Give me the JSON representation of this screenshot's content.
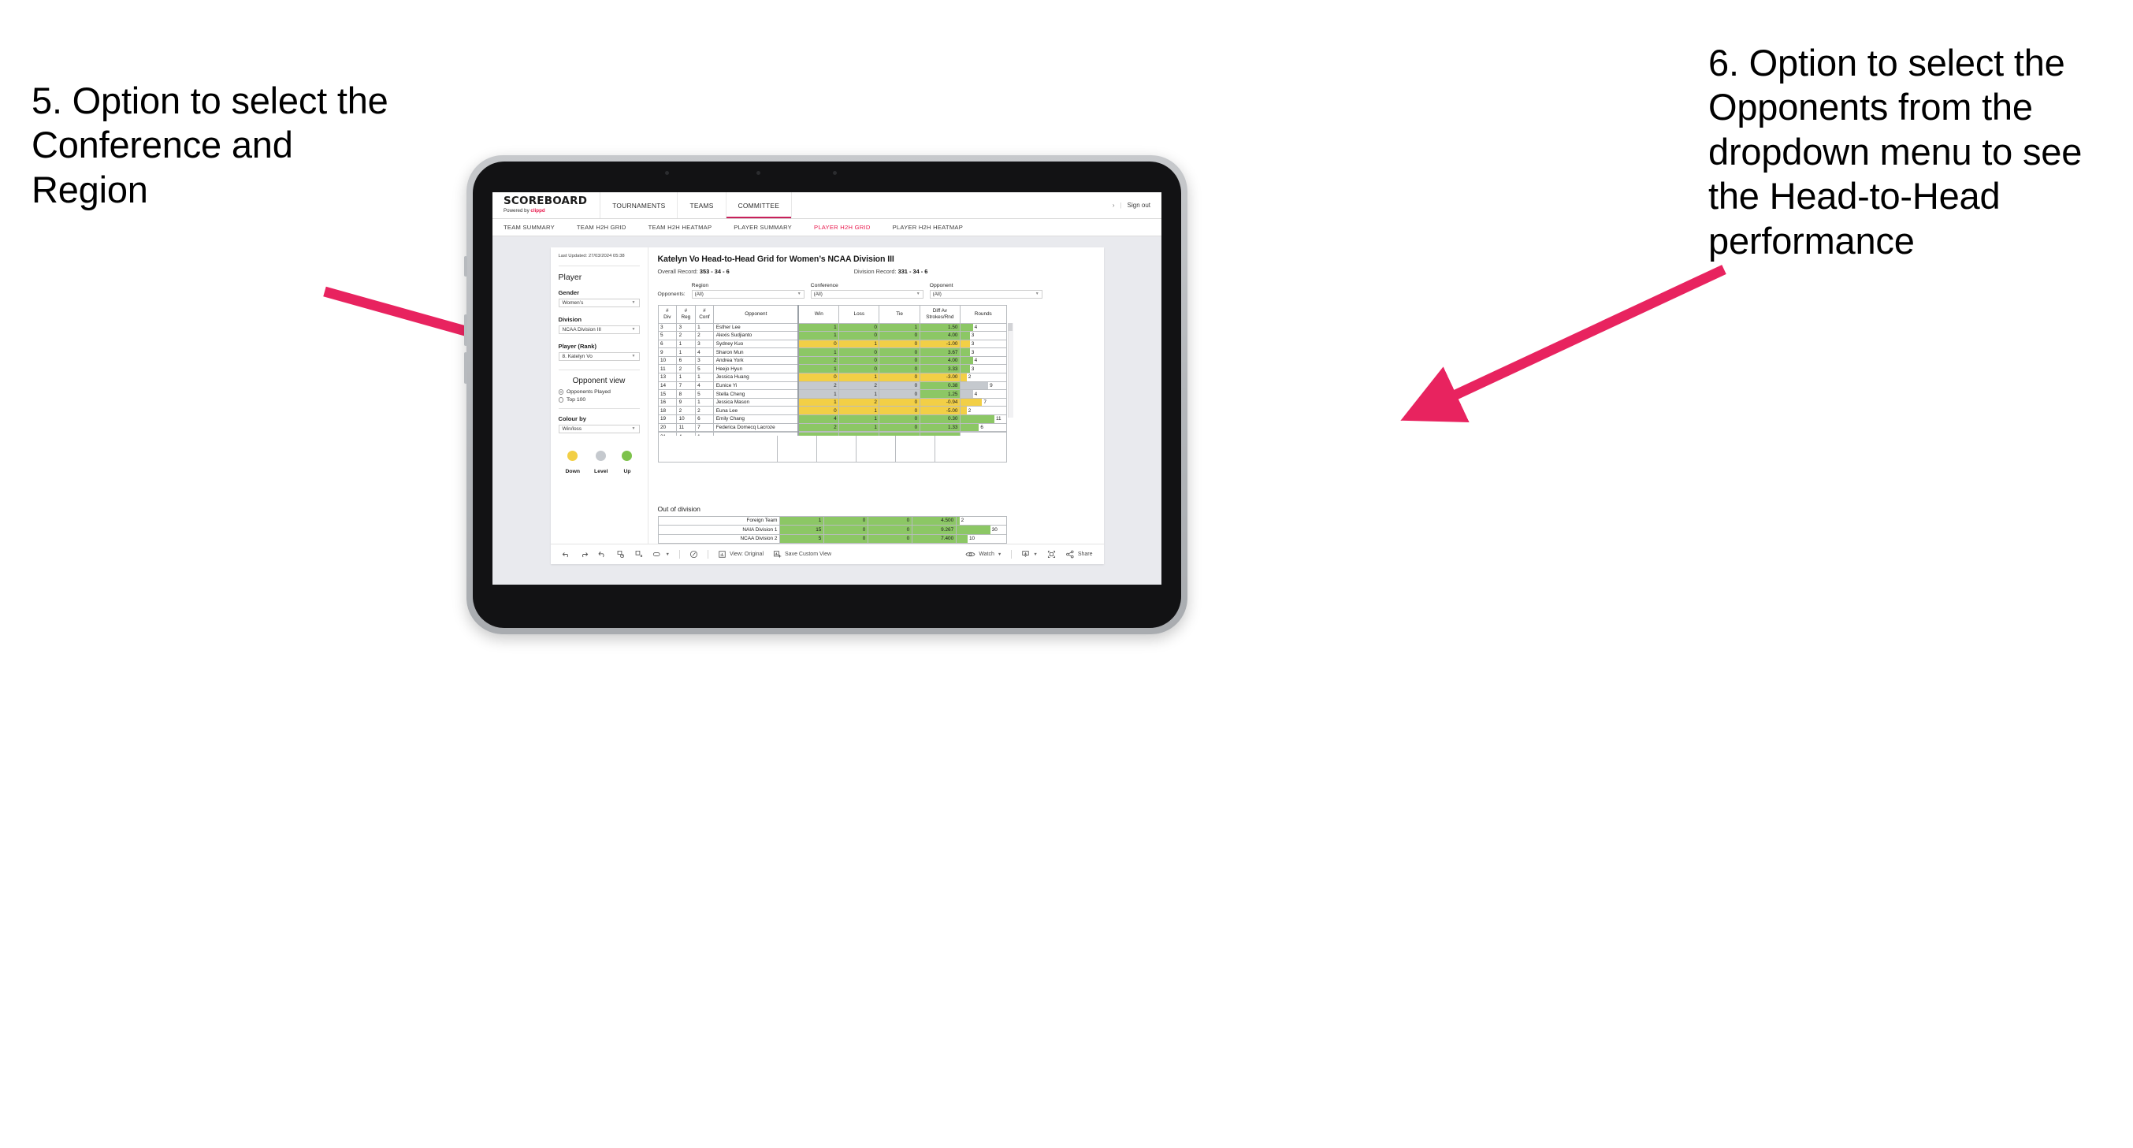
{
  "annotations": {
    "left": "5. Option to select the Conference and Region",
    "right": "6. Option to select the Opponents from the dropdown menu to see the Head-to-Head performance",
    "arrow_color": "#E8235F"
  },
  "app": {
    "brand": {
      "title": "SCOREBOARD",
      "powered_prefix": "Powered by ",
      "powered_brand": "clippd"
    },
    "topnav": [
      {
        "label": "TOURNAMENTS",
        "active": false
      },
      {
        "label": "TEAMS",
        "active": false
      },
      {
        "label": "COMMITTEE",
        "active": true
      }
    ],
    "topnav_right": {
      "chevron": "›",
      "divider": "|",
      "sign_out": "Sign out"
    },
    "subnav": [
      {
        "label": "TEAM SUMMARY",
        "active": false
      },
      {
        "label": "TEAM H2H GRID",
        "active": false
      },
      {
        "label": "TEAM H2H HEATMAP",
        "active": false
      },
      {
        "label": "PLAYER SUMMARY",
        "active": false
      },
      {
        "label": "PLAYER H2H GRID",
        "active": true
      },
      {
        "label": "PLAYER H2H HEATMAP",
        "active": false
      }
    ]
  },
  "sidebar": {
    "last_updated": "Last Updated: 27/03/2024 05:38",
    "section_player": "Player",
    "fields": [
      {
        "label": "Gender",
        "value": "Women’s"
      },
      {
        "label": "Division",
        "value": "NCAA Division III"
      },
      {
        "label": "Player (Rank)",
        "value": "8. Katelyn Vo"
      }
    ],
    "opponent_view": {
      "heading": "Opponent view",
      "options": [
        {
          "label": "Opponents Played",
          "selected": true
        },
        {
          "label": "Top 100",
          "selected": false
        }
      ]
    },
    "colour_by": {
      "label": "Colour by",
      "value": "Win/loss"
    },
    "legend": [
      {
        "label": "Down",
        "color": "#F2CF46"
      },
      {
        "label": "Level",
        "color": "#C5C9CE"
      },
      {
        "label": "Up",
        "color": "#7DC24B"
      }
    ]
  },
  "main": {
    "title": "Katelyn Vo Head-to-Head Grid for Women’s NCAA Division III",
    "overall_record_label": "Overall Record: ",
    "overall_record_value": "353 - 34 - 6",
    "division_record_label": "Division Record: ",
    "division_record_value": "331 -  34 - 6",
    "filters_label": "Opponents:",
    "filters": [
      {
        "label": "Region",
        "value": "(All)"
      },
      {
        "label": "Conference",
        "value": "(All)"
      },
      {
        "label": "Opponent",
        "value": "(All)"
      }
    ]
  },
  "chart_data": {
    "type": "table",
    "title": "Katelyn Vo Head-to-Head Grid for Women’s NCAA Division III",
    "columns": [
      "# Div",
      "# Reg",
      "# Conf",
      "Opponent",
      "Win",
      "Loss",
      "Tie",
      "Diff Av Strokes/Rnd",
      "Rounds"
    ],
    "column_headers_two_line": [
      {
        "top": "#",
        "bottom": "Div"
      },
      {
        "top": "#",
        "bottom": "Reg"
      },
      {
        "top": "#",
        "bottom": "Conf"
      },
      {
        "top": "",
        "bottom": "Opponent"
      },
      {
        "top": "",
        "bottom": "Win"
      },
      {
        "top": "",
        "bottom": "Loss"
      },
      {
        "top": "",
        "bottom": "Tie"
      },
      {
        "top": "Diff Av",
        "bottom": "Strokes/Rnd"
      },
      {
        "top": "",
        "bottom": "Rounds"
      }
    ],
    "rows": [
      {
        "div": "3",
        "reg": "3",
        "conf": "1",
        "opponent": "Esther Lee",
        "win": "1",
        "loss": "0",
        "tie": "1",
        "diff": "1.50",
        "rounds": "4",
        "rounds_num": 4,
        "color": "#8CC765"
      },
      {
        "div": "5",
        "reg": "2",
        "conf": "2",
        "opponent": "Alexis Sudjianto",
        "win": "1",
        "loss": "0",
        "tie": "0",
        "diff": "4.00",
        "rounds": "3",
        "rounds_num": 3,
        "color": "#8CC765"
      },
      {
        "div": "6",
        "reg": "1",
        "conf": "3",
        "opponent": "Sydney Kuo",
        "win": "0",
        "loss": "1",
        "tie": "0",
        "diff": "-1.00",
        "rounds": "3",
        "rounds_num": 3,
        "color": "#F2CF46"
      },
      {
        "div": "9",
        "reg": "1",
        "conf": "4",
        "opponent": "Sharon Mun",
        "win": "1",
        "loss": "0",
        "tie": "0",
        "diff": "3.67",
        "rounds": "3",
        "rounds_num": 3,
        "color": "#8CC765"
      },
      {
        "div": "10",
        "reg": "6",
        "conf": "3",
        "opponent": "Andrea York",
        "win": "2",
        "loss": "0",
        "tie": "0",
        "diff": "4.00",
        "rounds": "4",
        "rounds_num": 4,
        "color": "#8CC765"
      },
      {
        "div": "11",
        "reg": "2",
        "conf": "5",
        "opponent": "Heejo Hyun",
        "win": "1",
        "loss": "0",
        "tie": "0",
        "diff": "3.33",
        "rounds": "3",
        "rounds_num": 3,
        "color": "#8CC765"
      },
      {
        "div": "13",
        "reg": "1",
        "conf": "1",
        "opponent": "Jessica Huang",
        "win": "0",
        "loss": "1",
        "tie": "0",
        "diff": "-3.00",
        "rounds": "2",
        "rounds_num": 2,
        "color": "#F2CF46"
      },
      {
        "div": "14",
        "reg": "7",
        "conf": "4",
        "opponent": "Eunice Yi",
        "win": "2",
        "loss": "2",
        "tie": "0",
        "diff": "0.38",
        "rounds": "9",
        "rounds_num": 9,
        "color": "#C5C9CE",
        "diff_color": "#8CC765"
      },
      {
        "div": "15",
        "reg": "8",
        "conf": "5",
        "opponent": "Stella Cheng",
        "win": "1",
        "loss": "1",
        "tie": "0",
        "diff": "1.25",
        "rounds": "4",
        "rounds_num": 4,
        "color": "#C5C9CE",
        "diff_color": "#8CC765"
      },
      {
        "div": "16",
        "reg": "9",
        "conf": "1",
        "opponent": "Jessica Mason",
        "win": "1",
        "loss": "2",
        "tie": "0",
        "diff": "-0.94",
        "rounds": "7",
        "rounds_num": 7,
        "color": "#F2CF46"
      },
      {
        "div": "18",
        "reg": "2",
        "conf": "2",
        "opponent": "Euna Lee",
        "win": "0",
        "loss": "1",
        "tie": "0",
        "diff": "-5.00",
        "rounds": "2",
        "rounds_num": 2,
        "color": "#F2CF46"
      },
      {
        "div": "19",
        "reg": "10",
        "conf": "6",
        "opponent": "Emily Chang",
        "win": "4",
        "loss": "1",
        "tie": "0",
        "diff": "0.30",
        "rounds": "11",
        "rounds_num": 11,
        "color": "#8CC765"
      },
      {
        "div": "20",
        "reg": "11",
        "conf": "7",
        "opponent": "Federica Domecq Lacroze",
        "win": "2",
        "loss": "1",
        "tie": "0",
        "diff": "1.33",
        "rounds": "6",
        "rounds_num": 6,
        "color": "#8CC765"
      }
    ],
    "rounds_max": 11,
    "out_of_division": {
      "heading": "Out of division",
      "rows": [
        {
          "name": "Foreign Team",
          "win": "1",
          "loss": "0",
          "tie": "0",
          "diff": "4.500",
          "rounds": "2",
          "rounds_num": 2,
          "color": "#8CC765"
        },
        {
          "name": "NAIA Division 1",
          "win": "15",
          "loss": "0",
          "tie": "0",
          "diff": "9.267",
          "rounds": "30",
          "rounds_num": 30,
          "color": "#8CC765"
        },
        {
          "name": "NCAA Division 2",
          "win": "5",
          "loss": "0",
          "tie": "0",
          "diff": "7.400",
          "rounds": "10",
          "rounds_num": 10,
          "color": "#8CC765"
        }
      ],
      "rounds_max": 30
    }
  },
  "toolbar": {
    "view_label": "View: Original",
    "save_label": "Save Custom View",
    "watch_label": "Watch",
    "share_label": "Share"
  }
}
